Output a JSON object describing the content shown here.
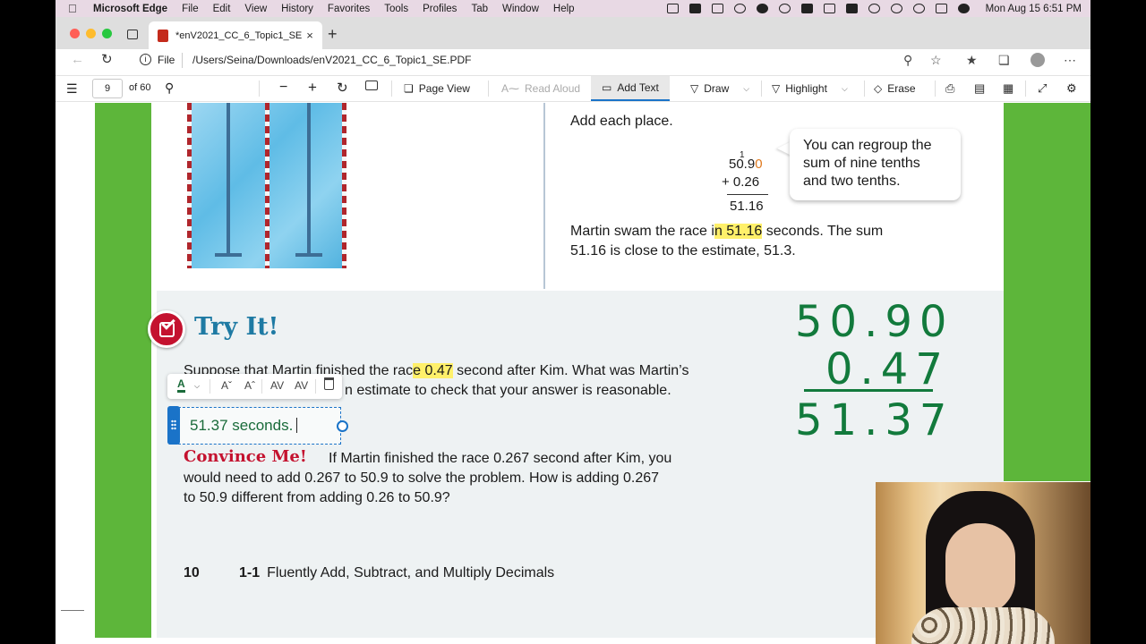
{
  "menubar": {
    "app_name": "Microsoft Edge",
    "items": [
      "File",
      "Edit",
      "View",
      "History",
      "Favorites",
      "Tools",
      "Profiles",
      "Tab",
      "Window",
      "Help"
    ],
    "clock": "Mon Aug 15  6:51 PM"
  },
  "browser": {
    "tab_title": "*enV2021_CC_6_Topic1_SE.PDF",
    "tab_close": "×",
    "new_tab": "+",
    "file_label": "File",
    "url": "/Users/Seina/Downloads/enV2021_CC_6_Topic1_SE.PDF"
  },
  "pdf_toolbar": {
    "page_number": "9",
    "page_total": "of 60",
    "page_view": "Page View",
    "read_aloud": "Read Aloud",
    "add_text": "Add Text",
    "draw": "Draw",
    "highlight": "Highlight",
    "erase": "Erase"
  },
  "document": {
    "add_each_place": "Add each place.",
    "regroup_mark": "1",
    "addend1_main": "50.9",
    "addend1_zero": "0",
    "addend2": "+ 0.26",
    "sum": "51.16",
    "bubble": [
      "You can regroup the",
      "sum of nine tenths",
      "and two tenths."
    ],
    "para1_line1_pre": "Martin swam the race i",
    "para1_line1_hl": "n 51.16",
    "para1_line1_post": " seconds. The sum",
    "para1_line2": "51.16 is close to the estimate, 51.3.",
    "try_it": "Try It!",
    "try_line1_pre": "Suppose that Martin finished the rac",
    "try_line1_hl": "e 0.47",
    "try_line1_post": " second after Kim. What was Martin’s",
    "try_line2_visible": "n estimate to check that your answer is reasonable.",
    "convince_title": "Convince Me!",
    "convince_line1": "If Martin finished the race 0.267 second after Kim, you",
    "convince_line2": "would need to add 0.267 to 50.9 to solve the problem. How is adding 0.267",
    "convince_line3": "to 50.9 different from adding 0.26 to 50.9?",
    "page_num": "10",
    "section_num": "1-1",
    "section_title": "Fluently Add, Subtract, and Multiply Decimals"
  },
  "annotation": {
    "text_value": "51.37 seconds."
  },
  "handwriting": {
    "line1": "50.90",
    "line2": "0.47",
    "line3": "51.37"
  },
  "colors": {
    "page_green": "#5db63a",
    "try_blue": "#1e7aa3",
    "convince_red": "#c4122f",
    "ink_green": "#127a3c",
    "highlight_yellow": "#fff06a",
    "accent_blue": "#1a73c8"
  }
}
